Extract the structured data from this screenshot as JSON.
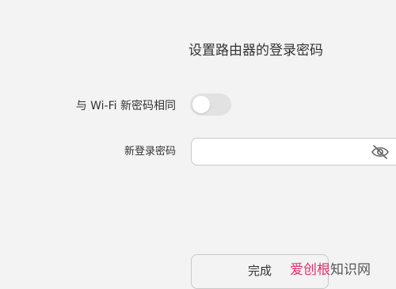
{
  "page": {
    "title": "设置路由器的登录密码"
  },
  "same_as_wifi": {
    "label": "与 Wi-Fi 新密码相同",
    "enabled": false
  },
  "new_login_password": {
    "label": "新登录密码",
    "value": "",
    "visibility_icon": "eye-icon"
  },
  "actions": {
    "done_label": "完成"
  },
  "watermark": {
    "part1": "爱创根",
    "part2": "知识网"
  },
  "colors": {
    "background": "#f3f3f3",
    "text": "#333333",
    "toggle_off": "#e2e2e2",
    "border": "#c8c8c8",
    "watermark_accent": "#e1306c"
  }
}
